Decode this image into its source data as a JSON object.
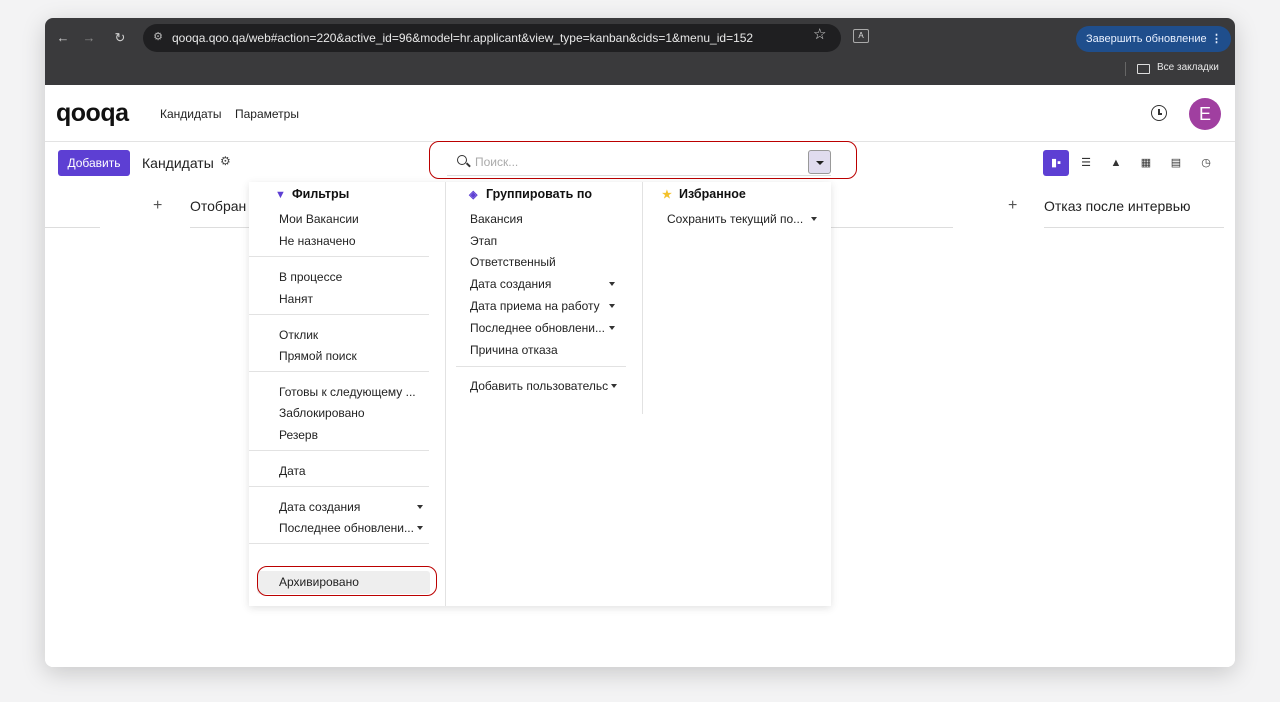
{
  "browser": {
    "url": "qooqa.qoo.qa/web#action=220&active_id=96&model=hr.applicant&view_type=kanban&cids=1&menu_id=152",
    "update_button": "Завершить обновление",
    "bookmarks_label": "Все закладки"
  },
  "app": {
    "logo": "qooqa",
    "menu": [
      "Кандидаты",
      "Параметры"
    ],
    "avatar_letter": "E",
    "avatar_color": "#a03fa0"
  },
  "control": {
    "add_button": "Добавить",
    "breadcrumb": "Кандидаты",
    "search_placeholder": "Поиск...",
    "accent_color": "#5d3fd3"
  },
  "views": [
    "kanban-icon",
    "list-icon",
    "graph-icon",
    "calendar-icon",
    "pivot-icon",
    "activity-icon"
  ],
  "kanban": {
    "columns": [
      {
        "title": "Отобран"
      },
      {
        "title": "Отказ после интервью"
      }
    ]
  },
  "filters": {
    "title": "Фильтры",
    "groups": [
      [
        "Мои Вакансии",
        "Не назначено"
      ],
      [
        "В процессе",
        "Нанят"
      ],
      [
        "Отклик",
        "Прямой поиск"
      ],
      [
        "Готовы к следующему ...",
        "Заблокировано",
        "Резерв"
      ],
      [
        "Дата"
      ],
      [
        "Дата создания",
        "Последнее обновлени..."
      ],
      [
        "Архивировано"
      ]
    ]
  },
  "groupby": {
    "title": "Группировать по",
    "items": [
      "Вакансия",
      "Этап",
      "Ответственный",
      "Дата создания",
      "Дата приема на работу",
      "Последнее обновлени...",
      "Причина отказа"
    ],
    "custom": "Добавить пользовательс"
  },
  "favorites": {
    "title": "Избранное",
    "save_current": "Сохранить текущий по..."
  }
}
